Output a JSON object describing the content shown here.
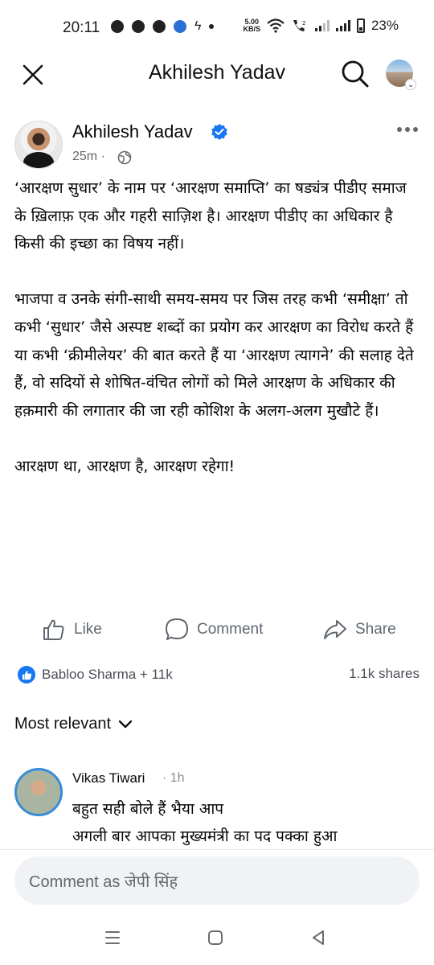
{
  "status_bar": {
    "time": "20:11",
    "speed_value": "5.00",
    "speed_unit": "KB/S",
    "battery": "23%"
  },
  "header": {
    "title": "Akhilesh Yadav"
  },
  "post": {
    "author": "Akhilesh Yadav",
    "time": "25m · ",
    "paragraphs": [
      "‘आरक्षण सुधार’ के नाम पर ‘आरक्षण समाप्ति’ का षड्यंत्र पीडीए समाज के ख़िलाफ़ एक और गहरी साज़िश है। आरक्षण पीडीए का अधिकार है किसी की इच्छा का विषय नहीं।",
      "भाजपा व उनके संगी-साथी समय-समय पर जिस तरह कभी ‘समीक्षा’ तो कभी ‘सुधार’ जैसे अस्पष्ट शब्दों का प्रयोग कर आरक्षण का विरोध करते हैं या कभी ‘क्रीमीलेयर’ की बात करते हैं या ‘आरक्षण त्यागने’ की सलाह देते हैं, वो सदियों से शोषित-वंचित लोगों को मिले आरक्षण के अधिकार की हक़मारी की लगातार की जा रही कोशिश के अलग-अलग मुखौटे हैं।",
      "आरक्षण था, आरक्षण है, आरक्षण रहेगा!"
    ]
  },
  "actions": {
    "like": "Like",
    "comment": "Comment",
    "share": "Share"
  },
  "reactions": {
    "text": "Babloo Sharma + 11k",
    "shares": "1.1k shares"
  },
  "sort": {
    "label": "Most relevant"
  },
  "comments": [
    {
      "name": "Vikas Tiwari",
      "time": "· 1h",
      "text_line1": "बहुत सही बोले हैं भैया आप",
      "text_line2": "अगली बार आपका मुख्यमंत्री का पद पक्का हुआ"
    }
  ],
  "composer": {
    "placeholder": "Comment as जेपी सिंह"
  },
  "colors": {
    "facebook_blue": "#1877f2",
    "secondary_text": "#65676b",
    "composer_bg": "#f0f2f5"
  }
}
